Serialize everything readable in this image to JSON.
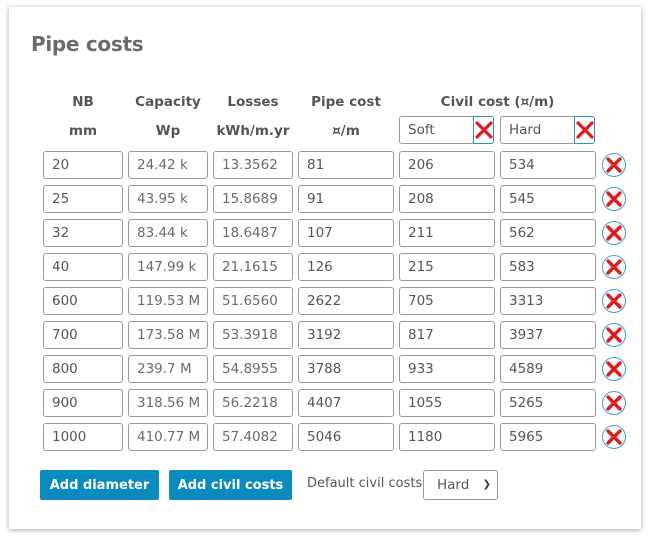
{
  "title": "Pipe costs",
  "columns": {
    "nb": {
      "label": "NB",
      "unit": "mm"
    },
    "capacity": {
      "label": "Capacity",
      "unit": "Wp"
    },
    "losses": {
      "label": "Losses",
      "unit": "kWh/m.yr"
    },
    "pipe_cost": {
      "label": "Pipe cost",
      "unit": "¤/m"
    },
    "civil_cost": {
      "label": "Civil cost (¤/m)"
    }
  },
  "civil_categories": [
    {
      "name": "Soft",
      "remove_icon": "red-x-icon"
    },
    {
      "name": "Hard",
      "remove_icon": "red-x-icon"
    }
  ],
  "rows": [
    {
      "nb": "20",
      "capacity": "24.42 k",
      "losses": "13.3562",
      "pipe_cost": "81",
      "soft": "206",
      "hard": "534"
    },
    {
      "nb": "25",
      "capacity": "43.95 k",
      "losses": "15.8689",
      "pipe_cost": "91",
      "soft": "208",
      "hard": "545"
    },
    {
      "nb": "32",
      "capacity": "83.44 k",
      "losses": "18.6487",
      "pipe_cost": "107",
      "soft": "211",
      "hard": "562"
    },
    {
      "nb": "40",
      "capacity": "147.99 k",
      "losses": "21.1615",
      "pipe_cost": "126",
      "soft": "215",
      "hard": "583"
    },
    {
      "nb": "600",
      "capacity": "119.53 M",
      "losses": "51.6560",
      "pipe_cost": "2622",
      "soft": "705",
      "hard": "3313"
    },
    {
      "nb": "700",
      "capacity": "173.58 M",
      "losses": "53.3918",
      "pipe_cost": "3192",
      "soft": "817",
      "hard": "3937"
    },
    {
      "nb": "800",
      "capacity": "239.7 M",
      "losses": "54.8955",
      "pipe_cost": "3788",
      "soft": "933",
      "hard": "4589"
    },
    {
      "nb": "900",
      "capacity": "318.56 M",
      "losses": "56.2218",
      "pipe_cost": "4407",
      "soft": "1055",
      "hard": "5265"
    },
    {
      "nb": "1000",
      "capacity": "410.77 M",
      "losses": "57.4082",
      "pipe_cost": "5046",
      "soft": "1180",
      "hard": "5965"
    }
  ],
  "row_delete_icon": "circled-red-x-icon",
  "footer": {
    "add_diameter_label": "Add diameter",
    "add_civil_costs_label": "Add civil costs",
    "default_civil_label": "Default civil costs:",
    "default_civil_value": "Hard"
  },
  "colors": {
    "accent": "#0a8bbd",
    "delete_red": "#e01b1b",
    "title": "#6b6b6b"
  }
}
